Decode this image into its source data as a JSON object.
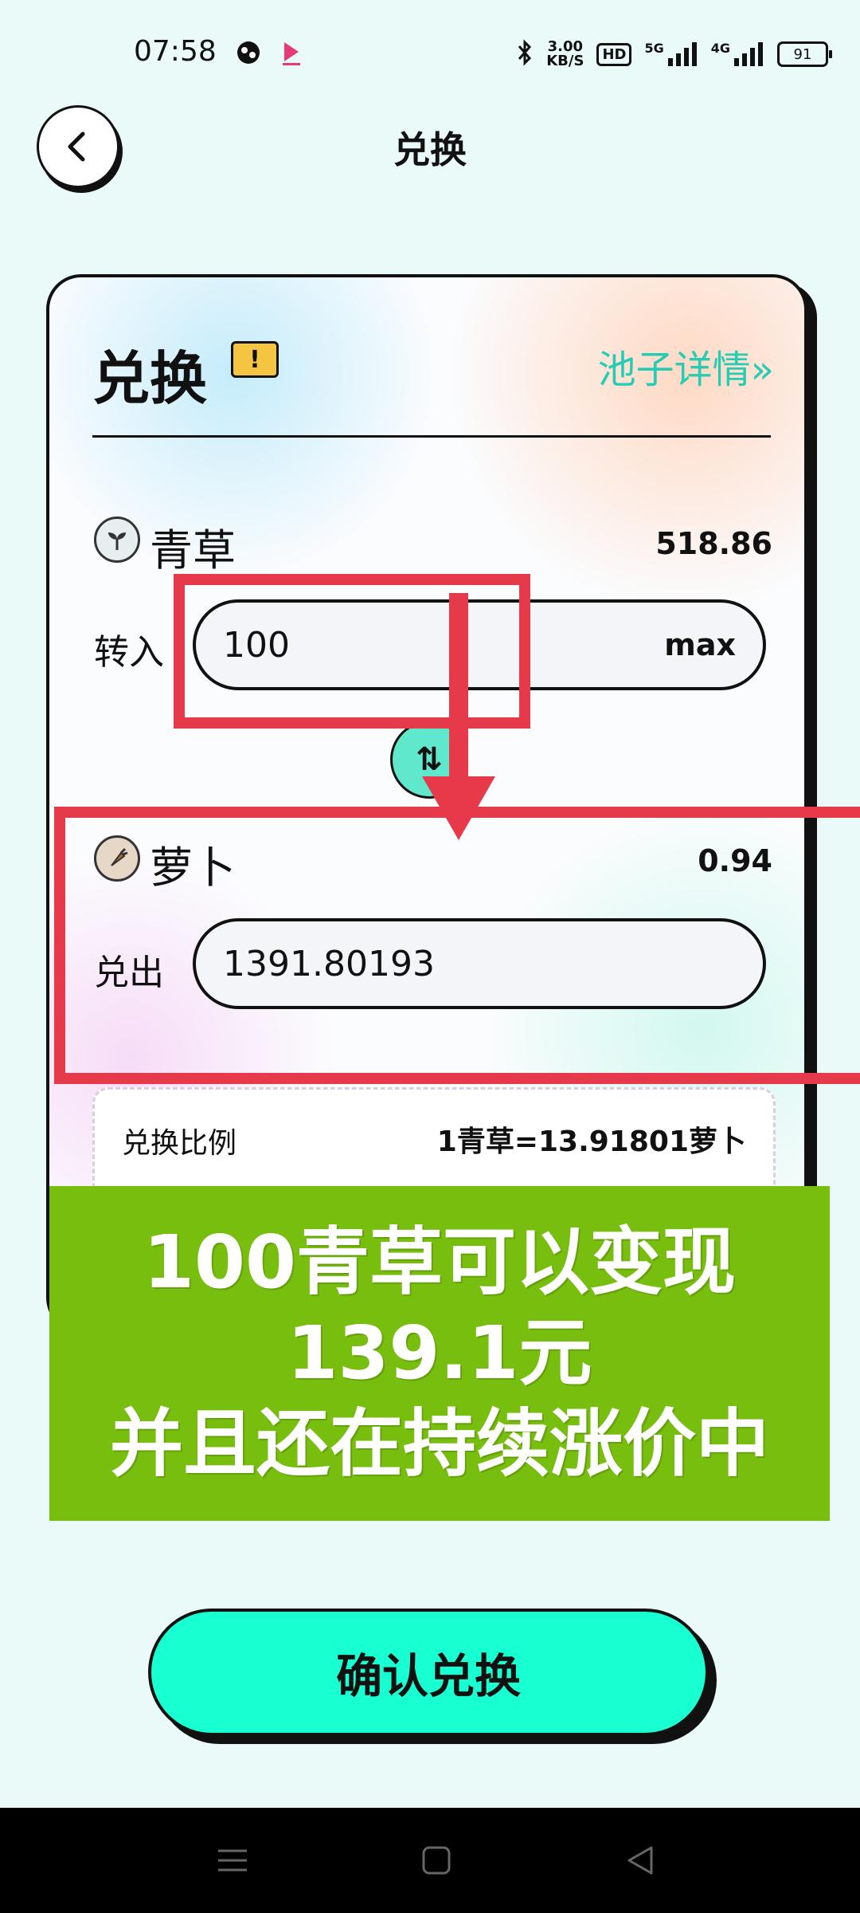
{
  "status_bar": {
    "time": "07:58",
    "net_speed_value": "3.00",
    "net_speed_unit": "KB/S",
    "hd_badge": "HD",
    "signal_1": "5G",
    "signal_2": "4G",
    "battery": "91"
  },
  "header": {
    "title": "兑换"
  },
  "card": {
    "title": "兑换",
    "warning_glyph": "!",
    "pool_link": "池子详情»",
    "from_token": {
      "name": "青草",
      "balance": "518.86",
      "label": "转入",
      "amount": "100",
      "max_label": "max"
    },
    "swap_glyph": "⇅",
    "to_token": {
      "name": "萝卜",
      "balance": "0.94",
      "label": "兑出",
      "amount": "1391.80193"
    },
    "rate": {
      "label": "兑换比例",
      "value": "1青草=13.91801萝卜"
    }
  },
  "promo": {
    "line1": "100青草可以变现",
    "line2": "139.1元",
    "line3": "并且还在持续涨价中"
  },
  "confirm_button": "确认兑换",
  "colors": {
    "accent": "#18ffd2",
    "link": "#26ccb3",
    "annotation_red": "#e63a4b",
    "banner_green": "#77be0f"
  }
}
